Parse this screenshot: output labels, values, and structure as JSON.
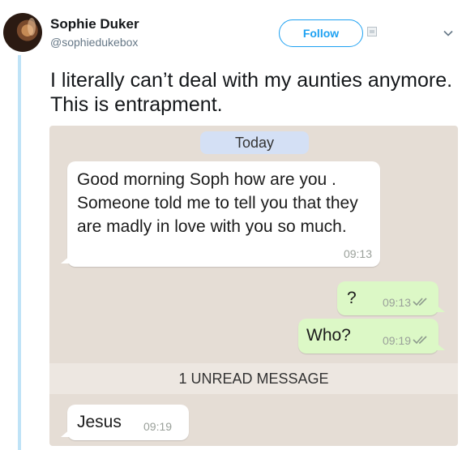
{
  "author": {
    "display_name": "Sophie Duker",
    "handle": "@sophiedukebox"
  },
  "header": {
    "follow_label": "Follow"
  },
  "tweet": {
    "text": "I literally can’t deal with my aunties anymore. This is entrapment."
  },
  "chat": {
    "date_label": "Today",
    "messages": [
      {
        "direction": "incoming",
        "text": "Good morning Soph  how are you . Someone told me to tell you that they are madly in  love with you so much.",
        "time": "09:13"
      },
      {
        "direction": "outgoing",
        "text": "?",
        "time": "09:13"
      },
      {
        "direction": "outgoing",
        "text": "Who?",
        "time": "09:19"
      }
    ],
    "unread_label": "1 UNREAD MESSAGE",
    "after_unread": [
      {
        "direction": "incoming",
        "text": "Jesus",
        "time": "09:19"
      }
    ]
  },
  "colors": {
    "accent": "#1da1f2",
    "chat_background": "#e5ddd5",
    "outgoing_bubble": "#dcf8c6",
    "incoming_bubble": "#ffffff",
    "tick_color": "#8d9a8d"
  },
  "icons": [
    "avatar",
    "broken-image-icon",
    "chevron-down-icon",
    "double-check-icon"
  ]
}
